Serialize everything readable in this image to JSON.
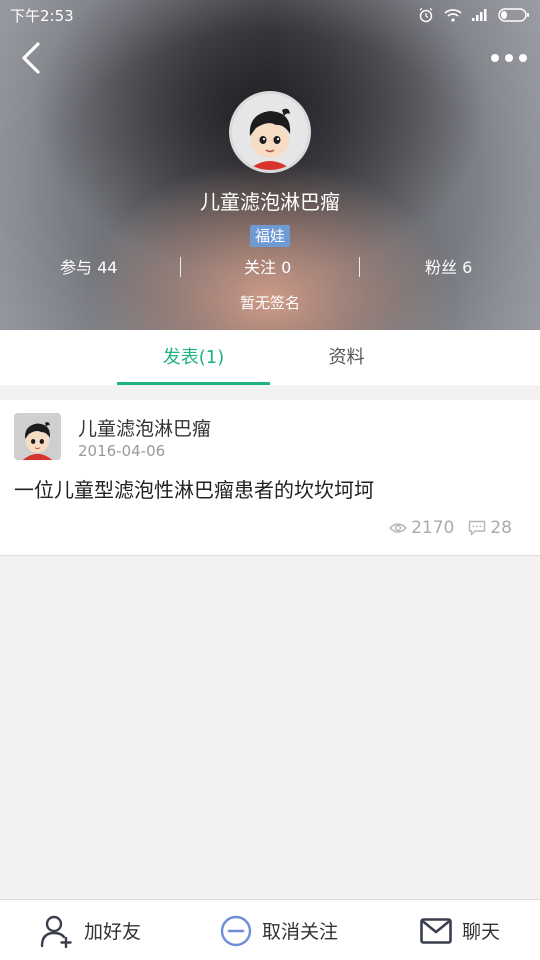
{
  "status_bar": {
    "time": "下午2:53"
  },
  "profile": {
    "name": "儿童滤泡淋巴瘤",
    "tag": "福娃",
    "stats": {
      "participate": "参与 44",
      "following": "关注 0",
      "fans": "粉丝 6"
    },
    "signature": "暂无签名"
  },
  "tabs": [
    {
      "label": "发表(1)",
      "active": true
    },
    {
      "label": "资料",
      "active": false
    }
  ],
  "post": {
    "author": "儿童滤泡淋巴瘤",
    "date": "2016-04-06",
    "title": "一位儿童型滤泡性淋巴瘤患者的坎坎坷坷",
    "views": "2170",
    "comments": "28"
  },
  "bottom_bar": {
    "add_friend": "加好友",
    "unfollow": "取消关注",
    "chat": "聊天"
  },
  "icons": {
    "back": "back-arrow-icon",
    "more": "more-dots-icon",
    "views": "eye-icon",
    "comments": "comment-icon",
    "add_friend": "add-user-icon",
    "unfollow": "minus-circle-icon",
    "chat": "mail-icon"
  },
  "colors": {
    "accent_green": "#1fb37f",
    "tag_blue": "#6f9bd4",
    "unfollow_blue": "#6f8fd8"
  }
}
